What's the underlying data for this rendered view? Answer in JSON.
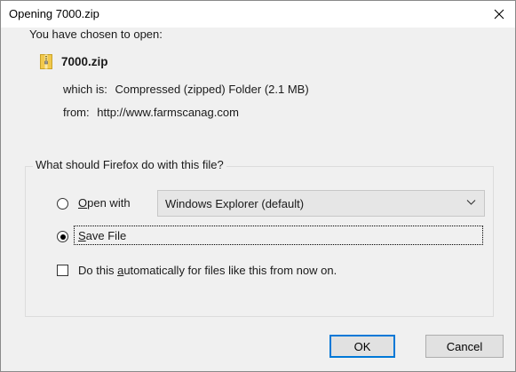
{
  "dialog": {
    "title": "Opening 7000.zip",
    "intro": "You have chosen to open:",
    "file_name": "7000.zip",
    "which_is_label": "which is:",
    "which_is_value": "Compressed (zipped) Folder (2.1 MB)",
    "from_label": "from:",
    "from_value": "http://www.farmscanag.com",
    "question": "What should Firefox do with this file?",
    "open_with": {
      "mnemonic": "O",
      "rest": "pen with",
      "selected": false
    },
    "open_with_select": {
      "value": "Windows Explorer (default)"
    },
    "save_file": {
      "mnemonic": "S",
      "rest": "ave File",
      "selected": true
    },
    "auto_checkbox": {
      "pre": "Do this ",
      "mnemonic": "a",
      "post": "utomatically for files like this from now on.",
      "checked": false
    },
    "ok_label": "OK",
    "cancel_label": "Cancel"
  },
  "icons": {
    "close": "close-icon",
    "file": "zip-folder-icon",
    "dropdown": "chevron-down-icon"
  },
  "colors": {
    "dialog_bg": "#f0f0f0",
    "title_bg": "#ffffff",
    "default_button_border": "#0078d7",
    "button_bg": "#e1e1e1",
    "zip_icon_yellow": "#f2c94c"
  }
}
